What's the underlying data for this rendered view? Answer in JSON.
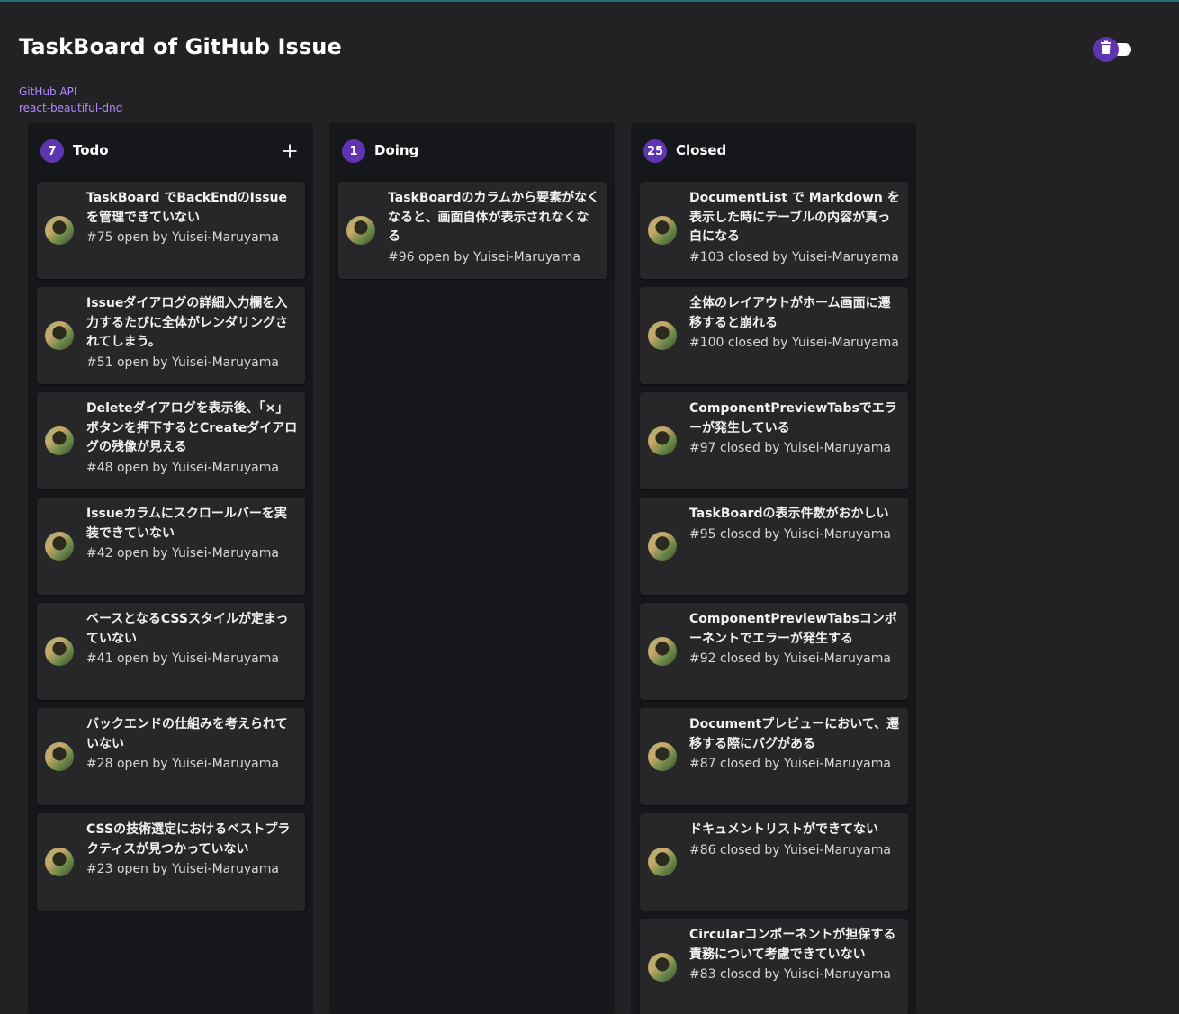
{
  "header": {
    "title": "TaskBoard of GitHub Issue",
    "links": [
      "GitHub API",
      "react-beautiful-dnd"
    ]
  },
  "theme": {
    "accent": "#5e35b1",
    "link": "#b388ff",
    "background": "#222224",
    "column_background": "#15171b",
    "card_background": "#272729"
  },
  "toggle": {
    "icon": "trash-icon",
    "checked": true
  },
  "columns": [
    {
      "title": "Todo",
      "count": "7",
      "add_icon": "plus-icon",
      "cards": [
        {
          "title": "TaskBoard でBackEndのIssueを管理できていない",
          "meta": "#75 open by Yuisei-Maruyama"
        },
        {
          "title": "Issueダイアログの詳細入力欄を入力するたびに全体がレンダリングされてしまう。",
          "meta": "#51 open by Yuisei-Maruyama"
        },
        {
          "title": "Deleteダイアログを表示後、「×」ボタンを押下するとCreateダイアログの残像が見える",
          "meta": "#48 open by Yuisei-Maruyama"
        },
        {
          "title": "Issueカラムにスクロールバーを実装できていない",
          "meta": "#42 open by Yuisei-Maruyama"
        },
        {
          "title": "ベースとなるCSSスタイルが定まっていない",
          "meta": "#41 open by Yuisei-Maruyama"
        },
        {
          "title": "バックエンドの仕組みを考えられていない",
          "meta": "#28 open by Yuisei-Maruyama"
        },
        {
          "title": "CSSの技術選定におけるベストプラクティスが見つかっていない",
          "meta": "#23 open by Yuisei-Maruyama"
        }
      ]
    },
    {
      "title": "Doing",
      "count": "1",
      "cards": [
        {
          "title": "TaskBoardのカラムから要素がなくなると、画面自体が表示されなくなる",
          "meta": "#96 open by Yuisei-Maruyama"
        }
      ]
    },
    {
      "title": "Closed",
      "count": "25",
      "cards": [
        {
          "title": "DocumentList で Markdown を表示した時にテーブルの内容が真っ白になる",
          "meta": "#103 closed by Yuisei-Maruyama"
        },
        {
          "title": "全体のレイアウトがホーム画面に遷移すると崩れる",
          "meta": "#100 closed by Yuisei-Maruyama"
        },
        {
          "title": "ComponentPreviewTabsでエラーが発生している",
          "meta": "#97 closed by Yuisei-Maruyama"
        },
        {
          "title": "TaskBoardの表示件数がおかしい",
          "meta": "#95 closed by Yuisei-Maruyama"
        },
        {
          "title": "ComponentPreviewTabsコンポーネントでエラーが発生する",
          "meta": "#92 closed by Yuisei-Maruyama"
        },
        {
          "title": "Documentプレビューにおいて、遷移する際にバグがある",
          "meta": "#87 closed by Yuisei-Maruyama"
        },
        {
          "title": "ドキュメントリストができてない",
          "meta": "#86 closed by Yuisei-Maruyama"
        },
        {
          "title": "Circularコンポーネントが担保する責務について考慮できていない",
          "meta": "#83 closed by Yuisei-Maruyama"
        }
      ]
    }
  ]
}
